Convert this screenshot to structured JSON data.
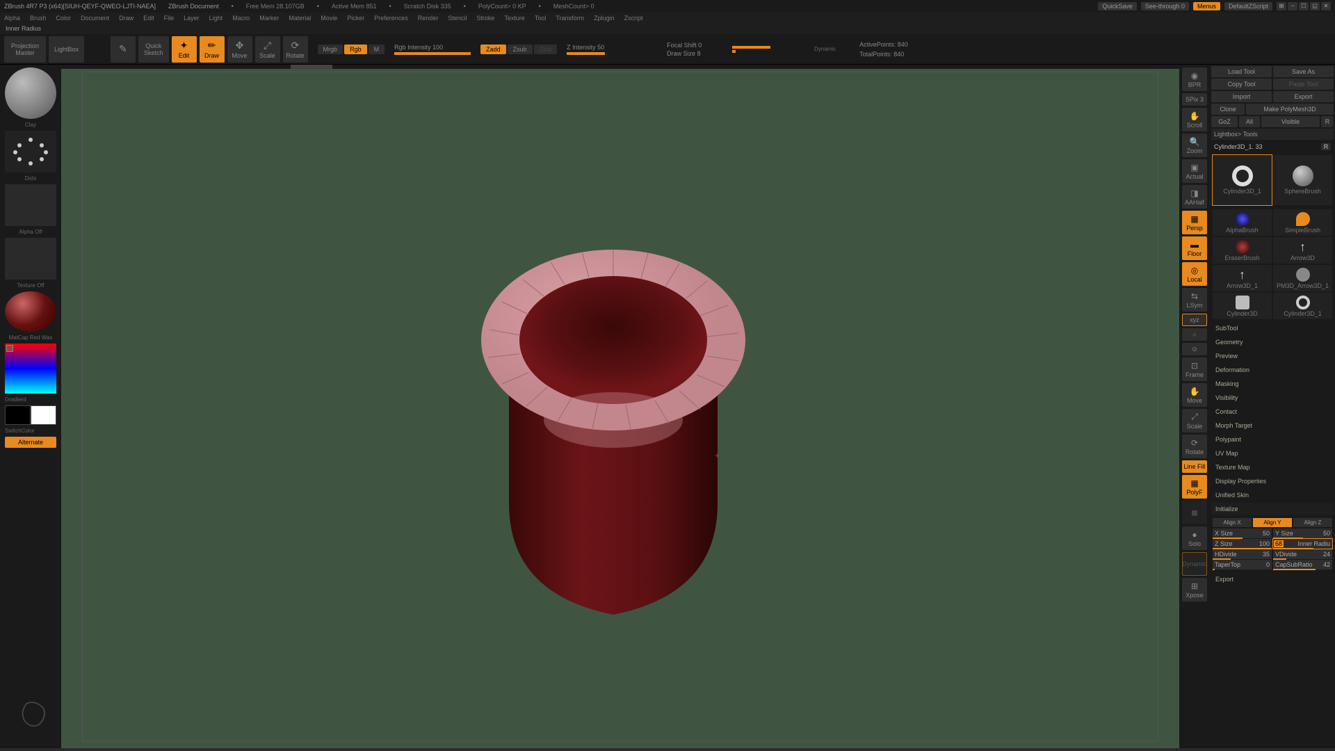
{
  "title_bar": {
    "app": "ZBrush 4R7 P3 (x64)[SIUH-QEYF-QWEO-LJTI-NAEA]",
    "doc": "ZBrush Document",
    "stats": [
      "Free Mem 28.107GB",
      "Active Mem 851",
      "Scratch Disk 335",
      "PolyCount> 0 KP",
      "MeshCount> 0"
    ],
    "quicksave": "QuickSave",
    "seethrough": "See-through  0",
    "menus": "Menus",
    "script": "DefaultZScript"
  },
  "menus": [
    "Alpha",
    "Brush",
    "Color",
    "Document",
    "Draw",
    "Edit",
    "File",
    "Layer",
    "Light",
    "Macro",
    "Marker",
    "Material",
    "Movie",
    "Picker",
    "Preferences",
    "Render",
    "Stencil",
    "Stroke",
    "Texture",
    "Tool",
    "Transform",
    "Zplugin",
    "Zscript"
  ],
  "hint": "Inner Radius",
  "toolbar": {
    "proj_master": "Projection\nMaster",
    "lightbox": "LightBox",
    "quicksketch": "Quick\nSketch",
    "modes": [
      "Edit",
      "Draw",
      "Move",
      "Scale",
      "Rotate"
    ],
    "channel": {
      "mrgb": "Mrgb",
      "rgb": "Rgb",
      "m": "M"
    },
    "zmode": {
      "zadd": "Zadd",
      "zsub": "Zsub",
      "zcut": "Zcut"
    },
    "rgb_intensity": {
      "label": "Rgb Intensity",
      "value": "100"
    },
    "z_intensity": {
      "label": "Z Intensity",
      "value": "50"
    },
    "focal_shift": {
      "label": "Focal Shift",
      "value": "0"
    },
    "draw_size": {
      "label": "Draw Size",
      "value": "8"
    },
    "dynamic": "Dynamic",
    "active_points": {
      "label": "ActivePoints:",
      "value": "840"
    },
    "total_points": {
      "label": "TotalPoints:",
      "value": "840"
    }
  },
  "left": {
    "clay": "Clay",
    "dots": "Dots",
    "alpha_off": "Alpha Off",
    "texture_off": "Texture Off",
    "matcap": "MatCap Red Wax",
    "gradient": "Gradient",
    "switchcolor": "SwitchColor",
    "alternate": "Alternate"
  },
  "strip": {
    "bpr": "BPR",
    "spix": "SPix 3",
    "scroll": "Scroll",
    "zoom": "Zoom",
    "actual": "Actual",
    "aa": "AAHalf",
    "persp": "Persp",
    "floor": "Floor",
    "local": "Local",
    "lsym": "LSym",
    "xyz": "xyz",
    "frame": "Frame",
    "move": "Move",
    "scale": "Scale",
    "rotate": "Rotate",
    "linefill": "Line Fill",
    "polyf": "PolyF",
    "solo": "Solo",
    "dynamic": "Dynamic",
    "xpose": "Xpose"
  },
  "right": {
    "load_tool": "Load Tool",
    "save_as": "Save As",
    "copy_tool": "Copy Tool",
    "paste_tool": "Paste Tool",
    "import": "Import",
    "export": "Export",
    "clone": "Clone",
    "polymesh": "Make PolyMesh3D",
    "goz": "GoZ",
    "all": "All",
    "visible": "Visible",
    "r": "R",
    "lightbox_tools": "Lightbox> Tools",
    "current_tool": "Cylinder3D_1. 33",
    "tools": [
      {
        "name": "Cylinder3D_1",
        "kind": "ring"
      },
      {
        "name": "SphereBrush",
        "kind": "sphere"
      },
      {
        "name": "AlphaBrush",
        "kind": "alpha"
      },
      {
        "name": "SimpleBrush",
        "kind": "simple"
      },
      {
        "name": "EraserBrush",
        "kind": "eraser"
      },
      {
        "name": "Arrow3D",
        "kind": "arrow"
      },
      {
        "name": "Arrow3D_1",
        "kind": "arrow"
      },
      {
        "name": "PM3D_Arrow3D_1",
        "kind": "pmarrow"
      },
      {
        "name": "Cylinder3D",
        "kind": "cyl"
      },
      {
        "name": "Cylinder3D_1",
        "kind": "ring-sm"
      }
    ],
    "palettes": [
      "SubTool",
      "Geometry",
      "Preview",
      "Deformation",
      "Masking",
      "Visibility",
      "Contact",
      "Morph Target",
      "Polypaint",
      "UV Map",
      "Texture Map",
      "Display Properties",
      "Unified Skin"
    ],
    "initialize": "Initialize",
    "align": {
      "x": "Align X",
      "y": "Align Y",
      "z": "Align Z"
    },
    "params": {
      "xsize": {
        "label": "X Size",
        "value": "50",
        "pct": 50
      },
      "ysize": {
        "label": "Y Size",
        "value": "50",
        "pct": 50
      },
      "zsize": {
        "label": "Z Size",
        "value": "100",
        "pct": 100
      },
      "inner": {
        "label": "Inner Radiu",
        "value": "68",
        "pct": 68
      },
      "hdiv": {
        "label": "HDivide",
        "value": "35",
        "pct": 30
      },
      "vdiv": {
        "label": "VDivide",
        "value": "24",
        "pct": 22
      },
      "taper": {
        "label": "TaperTop",
        "value": "0",
        "pct": 3
      },
      "capsub": {
        "label": "CapSubRatio",
        "value": "42",
        "pct": 72
      }
    },
    "export_bottom": "Export"
  }
}
